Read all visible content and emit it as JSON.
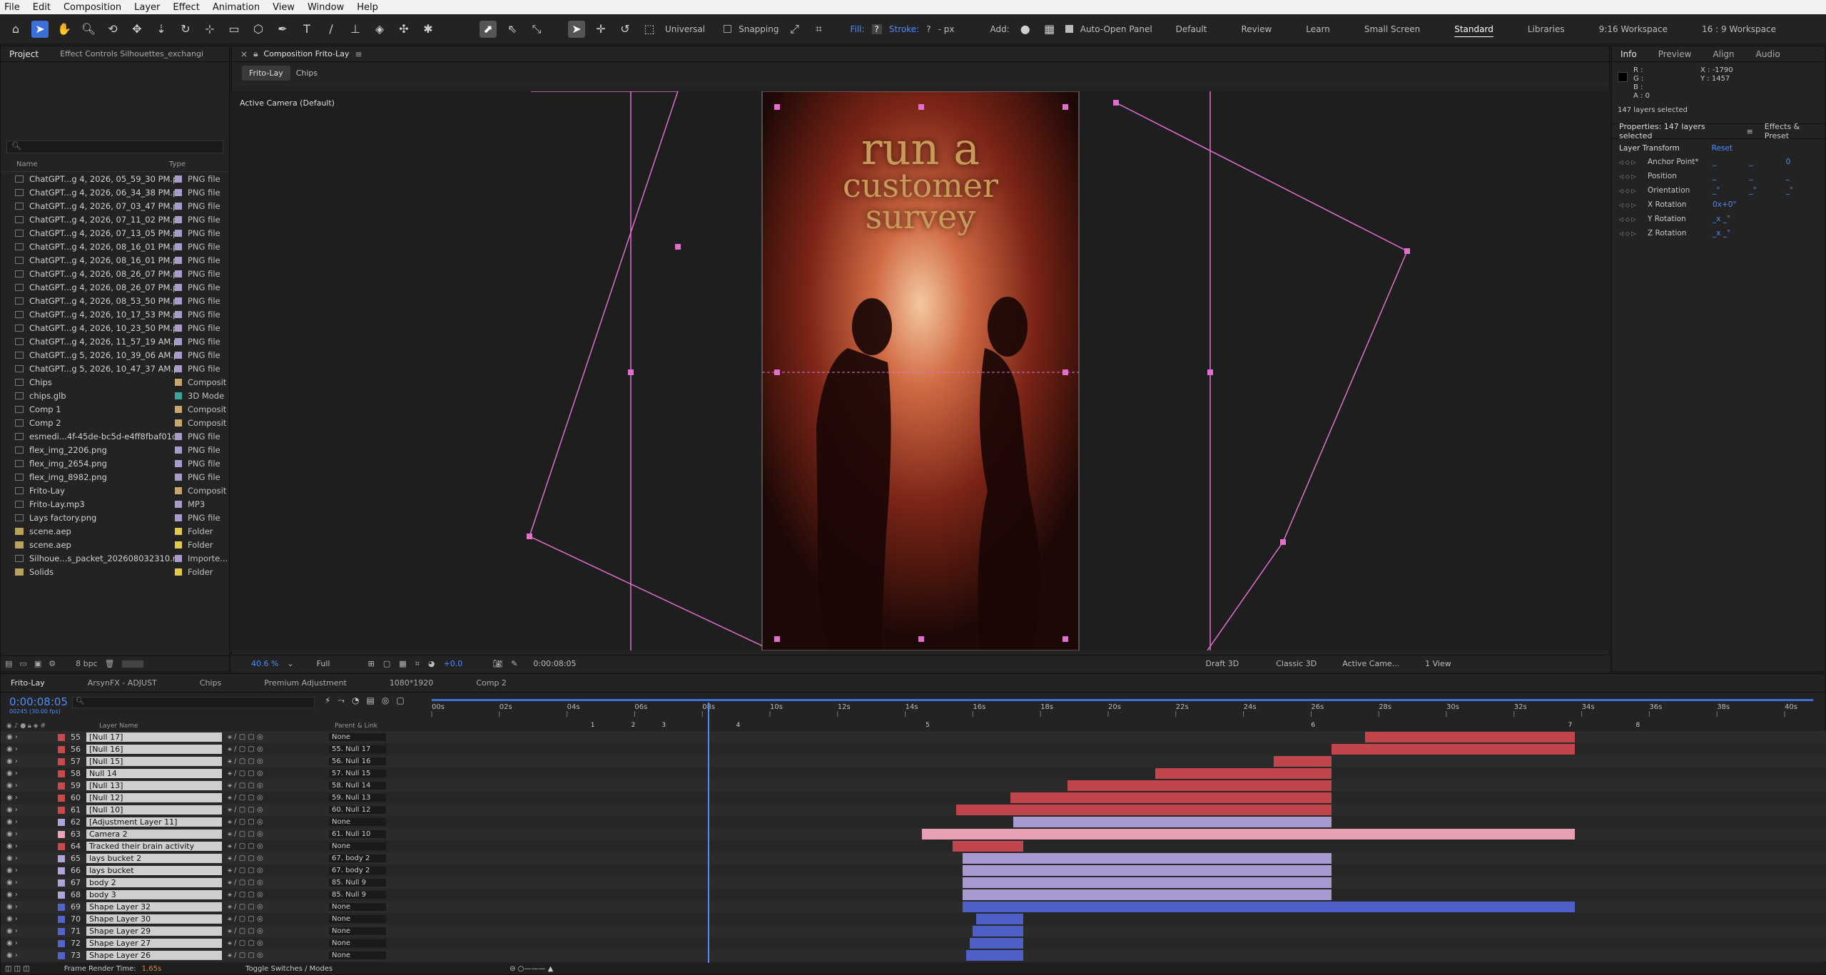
{
  "menu": [
    "File",
    "Edit",
    "Composition",
    "Layer",
    "Effect",
    "Animation",
    "View",
    "Window",
    "Help"
  ],
  "toolbar": {
    "universal": "Universal",
    "snapping": "Snapping",
    "fill": "Fill:",
    "fill_q": "?",
    "stroke": "Stroke:",
    "stroke_q": "?",
    "px": "- px",
    "add": "Add:",
    "auto_open": "Auto-Open Panel",
    "workspaces": [
      "Default",
      "Review",
      "Learn",
      "Small Screen",
      "Standard",
      "Libraries",
      "9:16 Workspace",
      "16 : 9 Workspace"
    ],
    "active_workspace": "Standard"
  },
  "project": {
    "tab_project": "Project",
    "tab_effects": "Effect Controls Silhouettes_exchangi",
    "col_name": "Name",
    "col_type": "Type",
    "items": [
      {
        "name": "ChatGPT...g 4, 2026, 05_59_30 PM.png",
        "type": "PNG file",
        "color": "#a99ccc"
      },
      {
        "name": "ChatGPT...g 4, 2026, 06_34_38 PM.png",
        "type": "PNG file",
        "color": "#a99ccc"
      },
      {
        "name": "ChatGPT...g 4, 2026, 07_03_47 PM.png",
        "type": "PNG file",
        "color": "#a99ccc"
      },
      {
        "name": "ChatGPT...g 4, 2026, 07_11_02 PM.png",
        "type": "PNG file",
        "color": "#a99ccc"
      },
      {
        "name": "ChatGPT...g 4, 2026, 07_13_05 PM.png",
        "type": "PNG file",
        "color": "#a99ccc"
      },
      {
        "name": "ChatGPT...g 4, 2026, 08_16_01 PM.png",
        "type": "PNG file",
        "color": "#a99ccc"
      },
      {
        "name": "ChatGPT...g 4, 2026, 08_16_01 PM.png",
        "type": "PNG file",
        "color": "#a99ccc"
      },
      {
        "name": "ChatGPT...g 4, 2026, 08_26_07 PM.png",
        "type": "PNG file",
        "color": "#a99ccc"
      },
      {
        "name": "ChatGPT...g 4, 2026, 08_26_07 PM.png",
        "type": "PNG file",
        "color": "#a99ccc"
      },
      {
        "name": "ChatGPT...g 4, 2026, 08_53_50 PM.png",
        "type": "PNG file",
        "color": "#a99ccc"
      },
      {
        "name": "ChatGPT...g 4, 2026, 10_17_53 PM.png",
        "type": "PNG file",
        "color": "#a99ccc"
      },
      {
        "name": "ChatGPT...g 4, 2026, 10_23_50 PM.png",
        "type": "PNG file",
        "color": "#a99ccc"
      },
      {
        "name": "ChatGPT...g 4, 2026, 11_57_19 AM.png",
        "type": "PNG file",
        "color": "#a99ccc"
      },
      {
        "name": "ChatGPT...g 5, 2026, 10_39_06 AM.png",
        "type": "PNG file",
        "color": "#a99ccc"
      },
      {
        "name": "ChatGPT...g 5, 2026, 10_47_37 AM.png",
        "type": "PNG file",
        "color": "#a99ccc"
      },
      {
        "name": "Chips",
        "type": "Composit",
        "color": "#c9a76b"
      },
      {
        "name": "chips.glb",
        "type": "3D Mode",
        "color": "#3aa79c"
      },
      {
        "name": "Comp 1",
        "type": "Composit",
        "color": "#c9a76b"
      },
      {
        "name": "Comp 2",
        "type": "Composit",
        "color": "#c9a76b"
      },
      {
        "name": "esmedi...4f-45de-bc5d-e4ff8fbaf01c.png",
        "type": "PNG file",
        "color": "#a99ccc"
      },
      {
        "name": "flex_img_2206.png",
        "type": "PNG file",
        "color": "#a99ccc"
      },
      {
        "name": "flex_img_2654.png",
        "type": "PNG file",
        "color": "#a99ccc"
      },
      {
        "name": "flex_img_8982.png",
        "type": "PNG file",
        "color": "#a99ccc"
      },
      {
        "name": "Frito-Lay",
        "type": "Composit",
        "color": "#c9a76b"
      },
      {
        "name": "Frito-Lay.mp3",
        "type": "MP3",
        "color": "#a99ccc"
      },
      {
        "name": "Lays factory.png",
        "type": "PNG file",
        "color": "#a99ccc"
      },
      {
        "name": "scene.aep",
        "type": "Folder",
        "color": "#e3c84a"
      },
      {
        "name": "scene.aep",
        "type": "Folder",
        "color": "#e3c84a"
      },
      {
        "name": "Silhoue...s_packet_202608032310.mp4",
        "type": "Importe...",
        "color": "#a99ccc"
      },
      {
        "name": "Solids",
        "type": "Folder",
        "color": "#e3c84a"
      }
    ],
    "bpc": "8 bpc"
  },
  "comp": {
    "panel_title": "Composition Frito-Lay",
    "tabs": [
      "Frito-Lay",
      "Chips"
    ],
    "camera_label": "Active Camera (Default)",
    "canvas_text": [
      "run a",
      "customer",
      "survey"
    ],
    "zoom": "40.6 %",
    "resolution": "Full",
    "exposure": "+0.0",
    "timecode": "0:00:08:05",
    "renderer": "Draft 3D",
    "classic": "Classic 3D",
    "camera_select": "Active Came...",
    "view_select": "1 View"
  },
  "info": {
    "tabs": [
      "Info",
      "Preview",
      "Align",
      "Audio"
    ],
    "rgba": [
      "R :",
      "G :",
      "B :",
      "A :  0"
    ],
    "x": "X : -1790",
    "y": "Y : 1457",
    "selected": "147 layers selected",
    "properties_title": "Properties: 147 layers selected",
    "effects_tab": "Effects & Preset",
    "layer_transform": "Layer Transform",
    "reset": "Reset",
    "props": [
      {
        "label": "Anchor Point*",
        "values": [
          "_",
          "_",
          "0"
        ]
      },
      {
        "label": "Position",
        "values": [
          "_",
          "_",
          "_"
        ]
      },
      {
        "label": "Orientation",
        "values": [
          "_°",
          "_°",
          "_°"
        ]
      },
      {
        "label": "X Rotation",
        "values": [
          "0x+0°",
          "",
          ""
        ]
      },
      {
        "label": "Y Rotation",
        "values": [
          "_x _°",
          "",
          ""
        ]
      },
      {
        "label": "Z Rotation",
        "values": [
          "_x _°",
          "",
          ""
        ]
      }
    ]
  },
  "timeline": {
    "tabs": [
      "Frito-Lay",
      "ArsynFX - ADJUST",
      "Chips",
      "Premium Adjustment",
      "1080*1920",
      "Comp 2"
    ],
    "timecode": "0:00:08:05",
    "fps_sub": "00245 (30.00 fps)",
    "col_layer": "Layer Name",
    "col_parent": "Parent & Link",
    "ruler": [
      "00s",
      "02s",
      "04s",
      "06s",
      "08s",
      "10s",
      "12s",
      "14s",
      "16s",
      "18s",
      "20s",
      "22s",
      "24s",
      "26s",
      "28s",
      "30s",
      "32s",
      "34s",
      "36s",
      "38s",
      "40s"
    ],
    "markers": [
      "1",
      "2",
      "3",
      "4",
      "5",
      "6",
      "7",
      "8"
    ],
    "layers": [
      {
        "num": "55",
        "name": "[Null 17]",
        "parent": "None",
        "color": "#c84a4a",
        "start": 27.6,
        "end": 33.8,
        "bar": "#c0464b"
      },
      {
        "num": "56",
        "name": "[Null 16]",
        "parent": "55. Null 17",
        "color": "#c84a4a",
        "start": 26.6,
        "end": 33.8,
        "bar": "#c0464b"
      },
      {
        "num": "57",
        "name": "[Null 15]",
        "parent": "56. Null 16",
        "color": "#c84a4a",
        "start": 24.9,
        "end": 26.6,
        "bar": "#c0464b"
      },
      {
        "num": "58",
        "name": "Null 14",
        "parent": "57. Null 15",
        "color": "#c84a4a",
        "start": 21.4,
        "end": 26.6,
        "bar": "#c0464b"
      },
      {
        "num": "59",
        "name": "[Null 13]",
        "parent": "58. Null 14",
        "color": "#c84a4a",
        "start": 18.8,
        "end": 26.6,
        "bar": "#c0464b"
      },
      {
        "num": "60",
        "name": "[Null 12]",
        "parent": "59. Null 13",
        "color": "#c84a4a",
        "start": 17.1,
        "end": 26.6,
        "bar": "#c0464b"
      },
      {
        "num": "61",
        "name": "[Null 10]",
        "parent": "60. Null 12",
        "color": "#c84a4a",
        "start": 15.5,
        "end": 26.6,
        "bar": "#c0464b"
      },
      {
        "num": "62",
        "name": "[Adjustment Layer 11]",
        "parent": "None",
        "color": "#b0a4d8",
        "start": 17.2,
        "end": 26.6,
        "bar": "#a89ad0"
      },
      {
        "num": "63",
        "name": "Camera 2",
        "parent": "61. Null 10",
        "color": "#e9a8b8",
        "start": 14.5,
        "end": 33.8,
        "bar": "#e8a0b4"
      },
      {
        "num": "64",
        "name": "Tracked their brain activity",
        "parent": "None",
        "color": "#c84a4a",
        "start": 15.4,
        "end": 17.5,
        "bar": "#c0464b"
      },
      {
        "num": "65",
        "name": "lays bucket 2",
        "parent": "67. body 2",
        "color": "#b0a4d8",
        "start": 15.7,
        "end": 26.6,
        "bar": "#a89ad0"
      },
      {
        "num": "66",
        "name": "lays bucket",
        "parent": "67. body 2",
        "color": "#b0a4d8",
        "start": 15.7,
        "end": 26.6,
        "bar": "#a89ad0"
      },
      {
        "num": "67",
        "name": "body 2",
        "parent": "85. Null 9",
        "color": "#b0a4d8",
        "start": 15.7,
        "end": 26.6,
        "bar": "#a89ad0"
      },
      {
        "num": "68",
        "name": "body 3",
        "parent": "85. Null 9",
        "color": "#b0a4d8",
        "start": 15.7,
        "end": 26.6,
        "bar": "#a89ad0"
      },
      {
        "num": "69",
        "name": "Shape Layer 32",
        "parent": "None",
        "color": "#5264c8",
        "start": 15.7,
        "end": 33.8,
        "bar": "#4e5fc8"
      },
      {
        "num": "70",
        "name": "Shape Layer 30",
        "parent": "None",
        "color": "#5264c8",
        "start": 16.1,
        "end": 17.5,
        "bar": "#4e5fc8"
      },
      {
        "num": "71",
        "name": "Shape Layer 29",
        "parent": "None",
        "color": "#5264c8",
        "start": 16.0,
        "end": 17.5,
        "bar": "#4e5fc8"
      },
      {
        "num": "72",
        "name": "Shape Layer 27",
        "parent": "None",
        "color": "#5264c8",
        "start": 15.9,
        "end": 17.5,
        "bar": "#4e5fc8"
      },
      {
        "num": "73",
        "name": "Shape Layer 26",
        "parent": "None",
        "color": "#5264c8",
        "start": 15.8,
        "end": 17.5,
        "bar": "#4e5fc8"
      }
    ],
    "footer_render": "Frame Render Time:",
    "footer_render_val": "1.65s",
    "footer_toggle": "Toggle Switches / Modes"
  }
}
